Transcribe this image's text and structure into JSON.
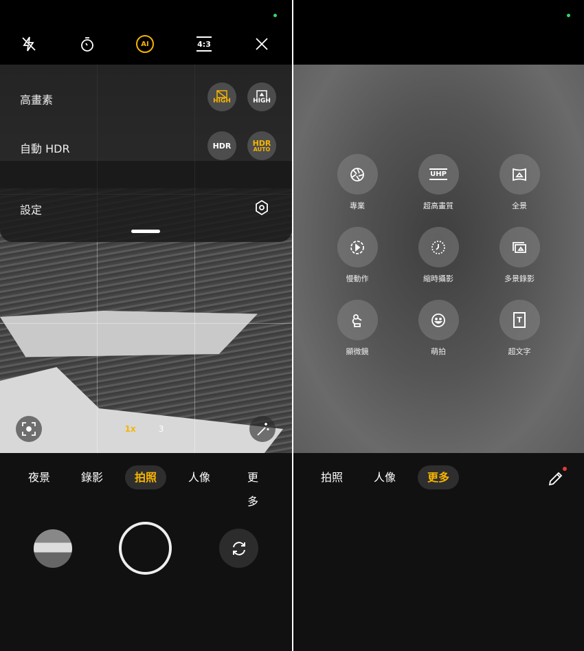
{
  "colors": {
    "accent": "#f7b500",
    "status_dot": "#3ad36b",
    "notification": "#e53935"
  },
  "left": {
    "top_icons": [
      "flash-off-icon",
      "timer-icon",
      "ai-icon",
      "aspect-ratio-icon",
      "close-icon"
    ],
    "ai_label": "AI",
    "aspect_label": "4:3",
    "quick_settings": {
      "high_pixel_label": "高畫素",
      "high_off": "HIGH",
      "high_on": "HIGH",
      "hdr_label": "自動 HDR",
      "hdr_off": "HDR",
      "hdr_auto_top": "HDR",
      "hdr_auto_bottom": "AUTO",
      "settings_label": "設定"
    },
    "zoom": {
      "active": "1x",
      "other": "3"
    },
    "modes": [
      {
        "label": "夜景"
      },
      {
        "label": "錄影"
      },
      {
        "label": "拍照",
        "active": true
      },
      {
        "label": "人像"
      },
      {
        "label": "更多"
      }
    ]
  },
  "right": {
    "more_modes": [
      {
        "label": "專業",
        "icon": "aperture-icon"
      },
      {
        "label": "超高畫質",
        "icon": "uhp-icon",
        "icon_text": "UHP"
      },
      {
        "label": "全景",
        "icon": "panorama-icon"
      },
      {
        "label": "慢動作",
        "icon": "slow-motion-icon"
      },
      {
        "label": "縮時攝影",
        "icon": "timelapse-icon"
      },
      {
        "label": "多景錄影",
        "icon": "multi-scene-video-icon"
      },
      {
        "label": "顯微鏡",
        "icon": "microscope-icon"
      },
      {
        "label": "萌拍",
        "icon": "smiley-icon"
      },
      {
        "label": "超文字",
        "icon": "text-document-icon",
        "icon_text": "T"
      }
    ],
    "modes": [
      {
        "label": "拍照"
      },
      {
        "label": "人像"
      },
      {
        "label": "更多",
        "active": true
      }
    ]
  }
}
